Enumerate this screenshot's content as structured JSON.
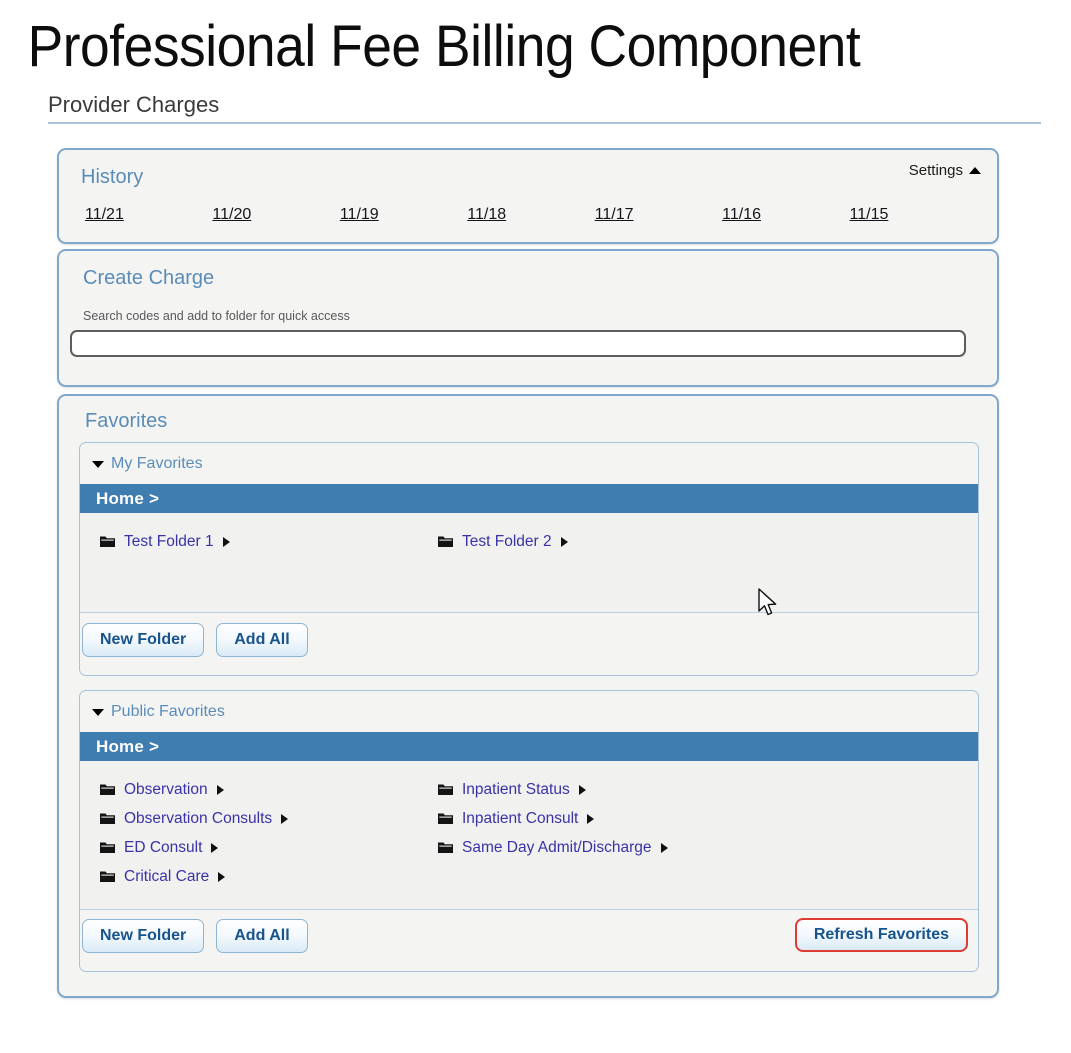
{
  "page": {
    "title": "Professional Fee Billing Component",
    "section_header": "Provider Charges"
  },
  "history": {
    "title": "History",
    "settings_label": "Settings",
    "settings_caret": "up-caret",
    "dates": [
      "11/21",
      "11/20",
      "11/19",
      "11/18",
      "11/17",
      "11/16",
      "11/15"
    ]
  },
  "create_charge": {
    "title": "Create Charge",
    "hint": "Search codes and add to folder for quick access",
    "search_value": "",
    "search_placeholder": ""
  },
  "favorites": {
    "title": "Favorites",
    "my_favorites": {
      "label": "My Favorites",
      "expanded": true,
      "breadcrumb": "Home >",
      "columns": [
        [
          "Test Folder 1"
        ],
        [
          "Test Folder 2"
        ]
      ],
      "buttons": [
        "New Folder",
        "Add All"
      ]
    },
    "public_favorites": {
      "label": "Public Favorites",
      "expanded": true,
      "breadcrumb": "Home >",
      "columns": [
        [
          "Observation",
          "Observation Consults",
          "ED Consult",
          "Critical Care"
        ],
        [
          "Inpatient Status",
          "Inpatient Consult",
          "Same Day Admit/Discharge"
        ]
      ],
      "buttons": [
        "New Folder",
        "Add All"
      ],
      "refresh_button": "Refresh Favorites"
    }
  },
  "colors": {
    "panel_border": "#7fa8cd",
    "panel_bg": "#f4f4f2",
    "header_blue": "#5b8cb8",
    "crumb_blue": "#3f7cb0",
    "link_purple": "#3a33a8",
    "button_text": "#17538c",
    "highlight_red": "#e03a34",
    "rule_blue": "#a9c6e0"
  }
}
